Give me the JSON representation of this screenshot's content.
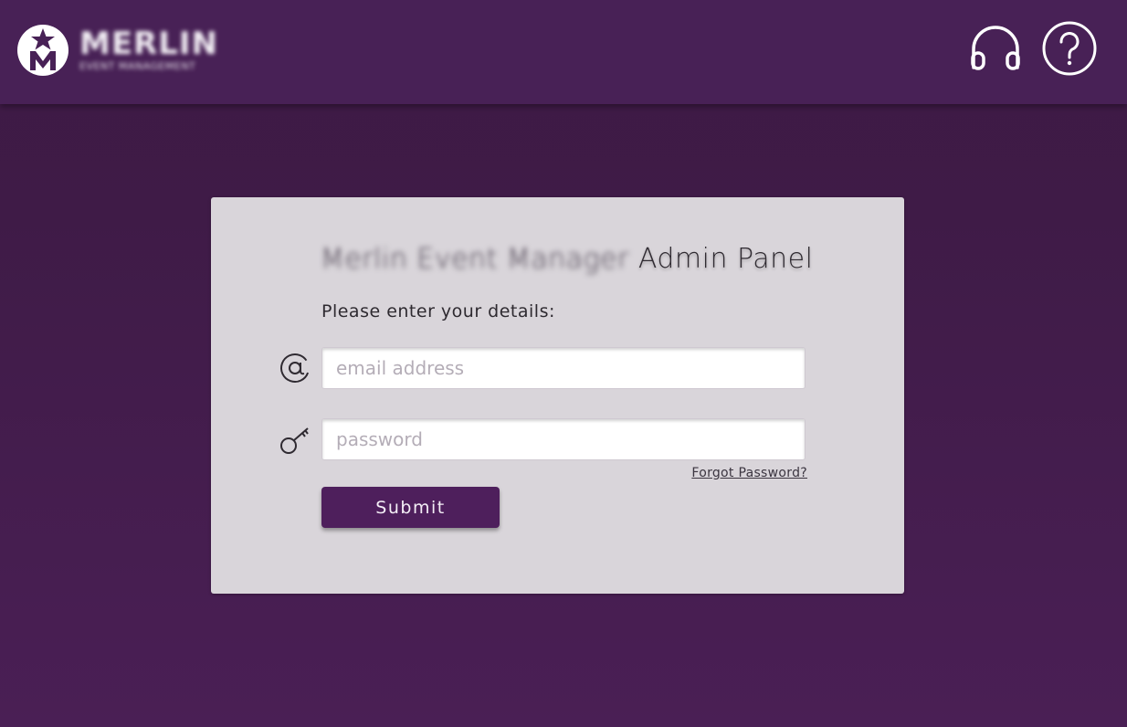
{
  "header": {
    "logo_wordmark": "MERLIN",
    "logo_tagline": "EVENT MANAGEMENT",
    "icons": [
      "star-m-logo-icon",
      "headset-icon",
      "help-circle-icon"
    ]
  },
  "card": {
    "title_prefix": "Merlin Event Manager",
    "title_suffix": "Admin Panel",
    "subtitle": "Please enter your details:",
    "email_placeholder": "email address",
    "email_value": "",
    "password_placeholder": "password",
    "password_value": "",
    "forgot_label": "Forgot Password?",
    "submit_label": "Submit",
    "icons": [
      "at-sign-icon",
      "key-icon"
    ]
  },
  "colors": {
    "header_bg": "#482156",
    "page_bg": "#3f1b47",
    "card_bg": "#d9d5da",
    "submit_bg": "#4e1f5c"
  }
}
